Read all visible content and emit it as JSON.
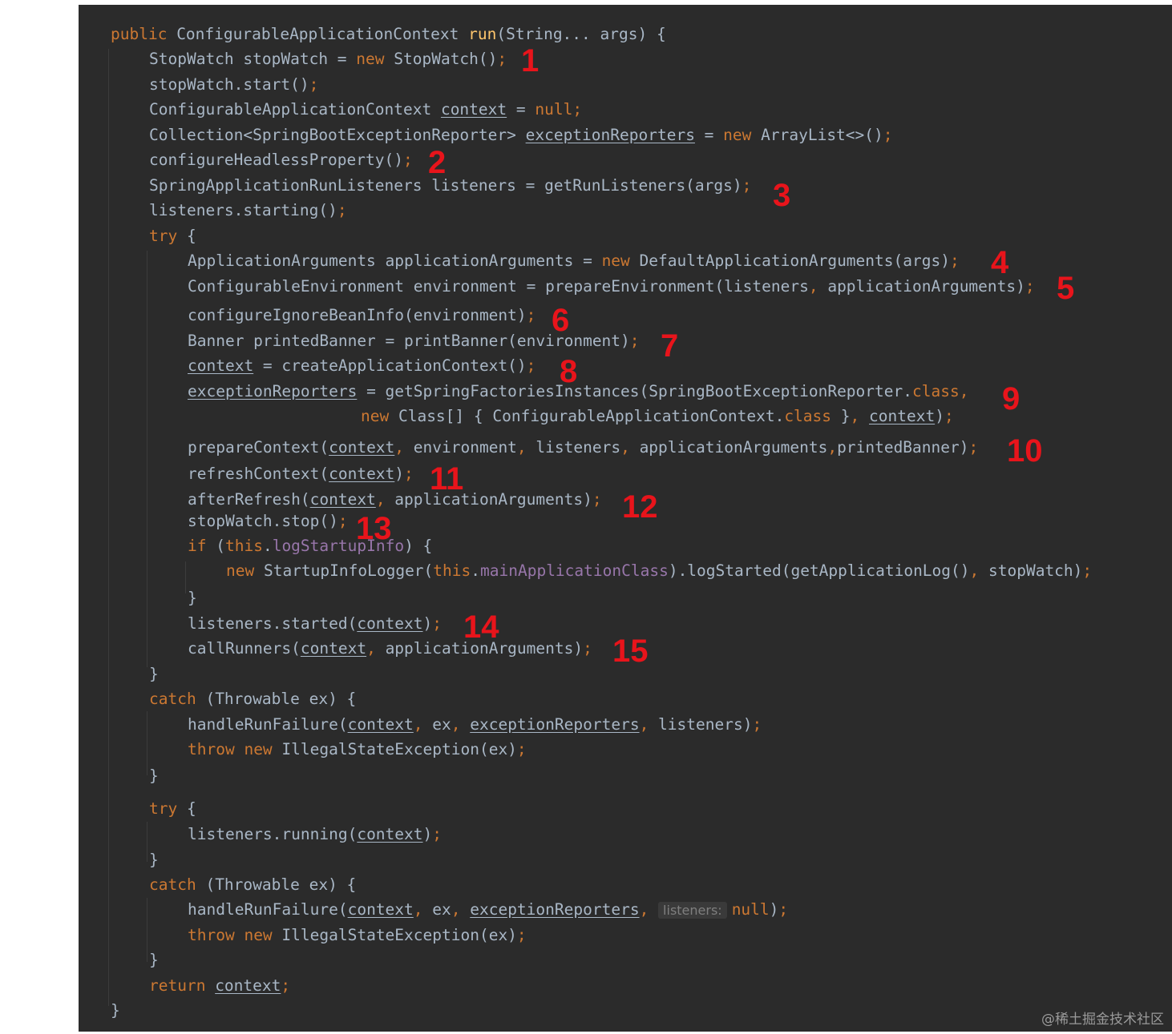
{
  "code_lines": [
    {
      "indent": 0,
      "tokens": [
        {
          "t": "public ",
          "c": "kw"
        },
        {
          "t": "ConfigurableApplicationContext ",
          "c": "txt"
        },
        {
          "t": "run",
          "c": "fn"
        },
        {
          "t": "(String... args) {",
          "c": "txt"
        }
      ]
    },
    {
      "indent": 1,
      "tokens": [
        {
          "t": "StopWatch stopWatch = ",
          "c": "txt"
        },
        {
          "t": "new ",
          "c": "kw"
        },
        {
          "t": "StopWatch()",
          "c": "txt"
        },
        {
          "t": ";",
          "c": "kw"
        }
      ]
    },
    {
      "indent": 1,
      "tokens": [
        {
          "t": "stopWatch.start()",
          "c": "txt"
        },
        {
          "t": ";",
          "c": "kw"
        }
      ]
    },
    {
      "indent": 1,
      "tokens": [
        {
          "t": "ConfigurableApplicationContext ",
          "c": "txt"
        },
        {
          "t": "context",
          "c": "txt u"
        },
        {
          "t": " = ",
          "c": "txt"
        },
        {
          "t": "null;",
          "c": "kw"
        }
      ]
    },
    {
      "indent": 1,
      "tokens": [
        {
          "t": "Collection<SpringBootExceptionReporter> ",
          "c": "txt"
        },
        {
          "t": "exceptionReporters",
          "c": "txt u"
        },
        {
          "t": " = ",
          "c": "txt"
        },
        {
          "t": "new ",
          "c": "kw"
        },
        {
          "t": "ArrayList<>()",
          "c": "txt"
        },
        {
          "t": ";",
          "c": "kw"
        }
      ]
    },
    {
      "indent": 1,
      "tokens": [
        {
          "t": "configureHeadlessProperty()",
          "c": "txt"
        },
        {
          "t": ";",
          "c": "kw"
        }
      ]
    },
    {
      "indent": 1,
      "tokens": [
        {
          "t": "SpringApplicationRunListeners listeners = getRunListeners(args)",
          "c": "txt"
        },
        {
          "t": ";",
          "c": "kw"
        }
      ]
    },
    {
      "indent": 1,
      "tokens": [
        {
          "t": "listeners.starting()",
          "c": "txt"
        },
        {
          "t": ";",
          "c": "kw"
        }
      ]
    },
    {
      "indent": 1,
      "tokens": [
        {
          "t": "try ",
          "c": "kw"
        },
        {
          "t": "{",
          "c": "txt"
        }
      ]
    },
    {
      "indent": 2,
      "tokens": [
        {
          "t": "ApplicationArguments applicationArguments = ",
          "c": "txt"
        },
        {
          "t": "new ",
          "c": "kw"
        },
        {
          "t": "DefaultApplicationArguments(args)",
          "c": "txt"
        },
        {
          "t": ";",
          "c": "kw"
        }
      ]
    },
    {
      "indent": 2,
      "tokens": [
        {
          "t": "ConfigurableEnvironment environment = prepareEnvironment(listeners",
          "c": "txt"
        },
        {
          "t": ", ",
          "c": "kw"
        },
        {
          "t": "applicationArguments)",
          "c": "txt"
        },
        {
          "t": ";",
          "c": "kw"
        }
      ]
    },
    {
      "indent": 2,
      "tokens": [
        {
          "t": "configureIgnoreBeanInfo(environment)",
          "c": "txt"
        },
        {
          "t": ";",
          "c": "kw"
        }
      ]
    },
    {
      "indent": 2,
      "tokens": [
        {
          "t": "Banner printedBanner = printBanner(environment)",
          "c": "txt"
        },
        {
          "t": ";",
          "c": "kw"
        }
      ]
    },
    {
      "indent": 2,
      "tokens": [
        {
          "t": "context",
          "c": "txt u"
        },
        {
          "t": " = createApplicationContext()",
          "c": "txt"
        },
        {
          "t": ";",
          "c": "kw"
        }
      ]
    },
    {
      "indent": 2,
      "tokens": [
        {
          "t": "exceptionReporters",
          "c": "txt u"
        },
        {
          "t": " = getSpringFactoriesInstances(SpringBootExceptionReporter.",
          "c": "txt"
        },
        {
          "t": "class, ",
          "c": "kw"
        }
      ]
    },
    {
      "indent": 6.5,
      "tokens": [
        {
          "t": "new ",
          "c": "kw"
        },
        {
          "t": "Class[] { ConfigurableApplicationContext.",
          "c": "txt"
        },
        {
          "t": "class ",
          "c": "kw"
        },
        {
          "t": "}",
          "c": "txt"
        },
        {
          "t": ", ",
          "c": "kw"
        },
        {
          "t": "context",
          "c": "txt u"
        },
        {
          "t": ")",
          "c": "txt"
        },
        {
          "t": ";",
          "c": "kw"
        }
      ]
    },
    {
      "indent": 2,
      "tokens": [
        {
          "t": "prepareContext(",
          "c": "txt"
        },
        {
          "t": "context",
          "c": "txt u"
        },
        {
          "t": ", ",
          "c": "kw"
        },
        {
          "t": "environment",
          "c": "txt"
        },
        {
          "t": ", ",
          "c": "kw"
        },
        {
          "t": "listeners",
          "c": "txt"
        },
        {
          "t": ", ",
          "c": "kw"
        },
        {
          "t": "applicationArguments",
          "c": "txt"
        },
        {
          "t": ",",
          "c": "kw"
        },
        {
          "t": "printedBanner)",
          "c": "txt"
        },
        {
          "t": ";",
          "c": "kw"
        }
      ]
    },
    {
      "indent": 2,
      "tokens": [
        {
          "t": "refreshContext(",
          "c": "txt"
        },
        {
          "t": "context",
          "c": "txt u"
        },
        {
          "t": ")",
          "c": "txt"
        },
        {
          "t": ";",
          "c": "kw"
        }
      ]
    },
    {
      "indent": 2,
      "tokens": [
        {
          "t": "afterRefresh(",
          "c": "txt"
        },
        {
          "t": "context",
          "c": "txt u"
        },
        {
          "t": ", ",
          "c": "kw"
        },
        {
          "t": "applicationArguments)",
          "c": "txt"
        },
        {
          "t": ";",
          "c": "kw"
        }
      ]
    },
    {
      "indent": 2,
      "tokens": [
        {
          "t": "stopWatch.stop()",
          "c": "txt"
        },
        {
          "t": ";",
          "c": "kw"
        }
      ]
    },
    {
      "indent": 2,
      "tokens": [
        {
          "t": "if ",
          "c": "kw"
        },
        {
          "t": "(",
          "c": "txt"
        },
        {
          "t": "this",
          "c": "kw"
        },
        {
          "t": ".",
          "c": "txt"
        },
        {
          "t": "logStartupInfo",
          "c": "fld"
        },
        {
          "t": ") {",
          "c": "txt"
        }
      ]
    },
    {
      "indent": 3,
      "tokens": [
        {
          "t": "new ",
          "c": "kw"
        },
        {
          "t": "StartupInfoLogger(",
          "c": "txt"
        },
        {
          "t": "this",
          "c": "kw"
        },
        {
          "t": ".",
          "c": "txt"
        },
        {
          "t": "mainApplicationClass",
          "c": "fld"
        },
        {
          "t": ").logStarted(getApplicationLog()",
          "c": "txt"
        },
        {
          "t": ", ",
          "c": "kw"
        },
        {
          "t": "stopWatch)",
          "c": "txt"
        },
        {
          "t": ";",
          "c": "kw"
        }
      ]
    },
    {
      "indent": 2,
      "tokens": [
        {
          "t": "}",
          "c": "txt"
        }
      ]
    },
    {
      "indent": 2,
      "tokens": [
        {
          "t": "listeners.started(",
          "c": "txt"
        },
        {
          "t": "context",
          "c": "txt u"
        },
        {
          "t": ")",
          "c": "txt"
        },
        {
          "t": ";",
          "c": "kw"
        }
      ]
    },
    {
      "indent": 2,
      "tokens": [
        {
          "t": "callRunners(",
          "c": "txt"
        },
        {
          "t": "context",
          "c": "txt u"
        },
        {
          "t": ", ",
          "c": "kw"
        },
        {
          "t": "applicationArguments)",
          "c": "txt"
        },
        {
          "t": ";",
          "c": "kw"
        }
      ]
    },
    {
      "indent": 1,
      "tokens": [
        {
          "t": "}",
          "c": "txt"
        }
      ]
    },
    {
      "indent": 1,
      "tokens": [
        {
          "t": "catch ",
          "c": "kw"
        },
        {
          "t": "(Throwable ex) {",
          "c": "txt"
        }
      ]
    },
    {
      "indent": 2,
      "tokens": [
        {
          "t": "handleRunFailure(",
          "c": "txt"
        },
        {
          "t": "context",
          "c": "txt u"
        },
        {
          "t": ", ",
          "c": "kw"
        },
        {
          "t": "ex",
          "c": "txt"
        },
        {
          "t": ", ",
          "c": "kw"
        },
        {
          "t": "exceptionReporters",
          "c": "txt u"
        },
        {
          "t": ", ",
          "c": "kw"
        },
        {
          "t": "listeners)",
          "c": "txt"
        },
        {
          "t": ";",
          "c": "kw"
        }
      ]
    },
    {
      "indent": 2,
      "tokens": [
        {
          "t": "throw ",
          "c": "kw"
        },
        {
          "t": "new ",
          "c": "kw"
        },
        {
          "t": "IllegalStateException(ex)",
          "c": "txt"
        },
        {
          "t": ";",
          "c": "kw"
        }
      ]
    },
    {
      "indent": 1,
      "tokens": [
        {
          "t": "}",
          "c": "txt"
        }
      ]
    },
    {
      "indent": 1,
      "tokens": [
        {
          "t": "try ",
          "c": "kw"
        },
        {
          "t": "{",
          "c": "txt"
        }
      ]
    },
    {
      "indent": 2,
      "tokens": [
        {
          "t": "listeners.running(",
          "c": "txt"
        },
        {
          "t": "context",
          "c": "txt u"
        },
        {
          "t": ")",
          "c": "txt"
        },
        {
          "t": ";",
          "c": "kw"
        }
      ]
    },
    {
      "indent": 1,
      "tokens": [
        {
          "t": "}",
          "c": "txt"
        }
      ]
    },
    {
      "indent": 1,
      "tokens": [
        {
          "t": "catch ",
          "c": "kw"
        },
        {
          "t": "(Throwable ex) {",
          "c": "txt"
        }
      ]
    },
    {
      "indent": 2,
      "tokens": [
        {
          "t": "handleRunFailure(",
          "c": "txt"
        },
        {
          "t": "context",
          "c": "txt u"
        },
        {
          "t": ", ",
          "c": "kw"
        },
        {
          "t": "ex",
          "c": "txt"
        },
        {
          "t": ", ",
          "c": "kw"
        },
        {
          "t": "exceptionReporters",
          "c": "txt u"
        },
        {
          "t": ", ",
          "c": "kw"
        },
        {
          "t": "listeners:",
          "c": "hint"
        },
        {
          "t": "null",
          "c": "kw"
        },
        {
          "t": ")",
          "c": "txt"
        },
        {
          "t": ";",
          "c": "kw"
        }
      ]
    },
    {
      "indent": 2,
      "tokens": [
        {
          "t": "throw ",
          "c": "kw"
        },
        {
          "t": "new ",
          "c": "kw"
        },
        {
          "t": "IllegalStateException(ex)",
          "c": "txt"
        },
        {
          "t": ";",
          "c": "kw"
        }
      ]
    },
    {
      "indent": 1,
      "tokens": [
        {
          "t": "}",
          "c": "txt"
        }
      ]
    },
    {
      "indent": 1,
      "tokens": [
        {
          "t": "return ",
          "c": "kw"
        },
        {
          "t": "context",
          "c": "txt u"
        },
        {
          "t": ";",
          "c": "kw"
        }
      ]
    },
    {
      "indent": 0,
      "tokens": [
        {
          "t": "}",
          "c": "txt"
        }
      ]
    }
  ],
  "annotations": [
    "1",
    "2",
    "3",
    "4",
    "5",
    "6",
    "7",
    "8",
    "9",
    "10",
    "11",
    "12",
    "13",
    "14",
    "15"
  ],
  "watermark": "@稀土掘金技术社区",
  "colors": {
    "editor_bg": "#2b2b2b",
    "keyword": "#cc7832",
    "method_decl": "#ffc66d",
    "field": "#9876aa",
    "text": "#a9b7c6",
    "annotation": "#e8141b"
  }
}
